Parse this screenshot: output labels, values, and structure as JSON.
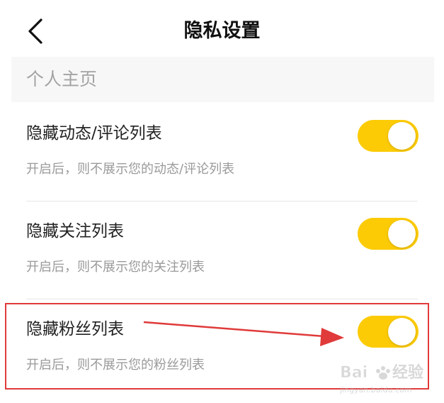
{
  "colors": {
    "toggle_on": "#fccb06",
    "annotation_red": "#e03a3a",
    "section_bg": "#f7f7f7"
  },
  "header": {
    "back_icon": "chevron-left-icon",
    "title": "隐私设置"
  },
  "section": {
    "label": "个人主页"
  },
  "settings": [
    {
      "title": "隐藏动态/评论列表",
      "description": "开启后，则不展示您的动态/评论列表",
      "enabled": true
    },
    {
      "title": "隐藏关注列表",
      "description": "开启后，则不展示您的关注列表",
      "enabled": true
    },
    {
      "title": "隐藏粉丝列表",
      "description": "开启后，则不展示您的粉丝列表",
      "enabled": true
    }
  ],
  "watermark": {
    "brand_left": "Bai",
    "brand_right": "经验",
    "url": "jingyan.baidu.com"
  }
}
